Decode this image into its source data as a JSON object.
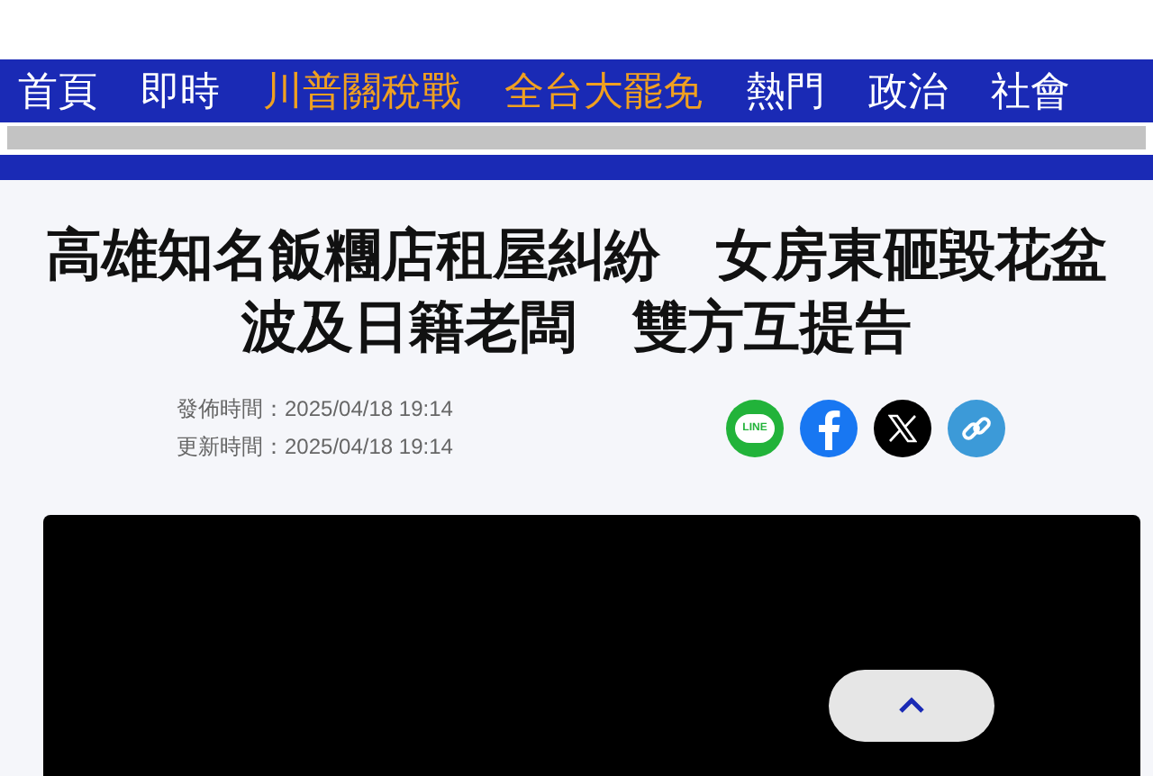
{
  "nav": {
    "items": [
      {
        "label": "首頁",
        "featured": false
      },
      {
        "label": "即時",
        "featured": false
      },
      {
        "label": "川普關稅戰",
        "featured": true
      },
      {
        "label": "全台大罷免",
        "featured": true
      },
      {
        "label": "熱門",
        "featured": false
      },
      {
        "label": "政治",
        "featured": false
      },
      {
        "label": "社會",
        "featured": false
      }
    ]
  },
  "article": {
    "title": "高雄知名飯糰店租屋糾紛　女房東砸毀花盆波及日籍老闆　雙方互提告",
    "published": "發佈時間：2025/04/18 19:14",
    "updated": "更新時間：2025/04/18 19:14",
    "share": [
      {
        "kind": "line",
        "label": "LINE"
      },
      {
        "kind": "facebook"
      },
      {
        "kind": "x"
      },
      {
        "kind": "link"
      }
    ]
  }
}
